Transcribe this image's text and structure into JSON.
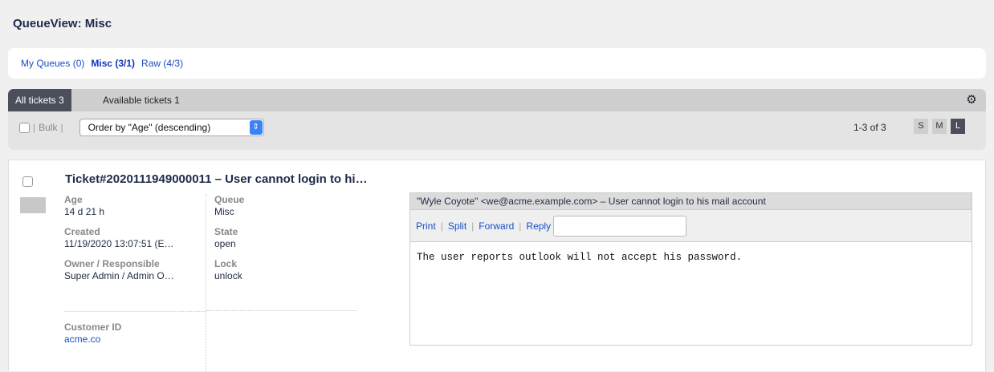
{
  "page": {
    "title": "QueueView: Misc"
  },
  "queues": [
    {
      "label": "My Queues (0)",
      "active": false
    },
    {
      "label": "Misc (3/1)",
      "active": true
    },
    {
      "label": "Raw (4/3)",
      "active": false
    }
  ],
  "tabs": {
    "all": "All tickets 3",
    "available": "Available tickets 1"
  },
  "toolbar": {
    "bulk_label": "Bulk",
    "order_value": "Order by \"Age\" (descending)",
    "pagination": "1-3 of 3",
    "sizes": [
      "S",
      "M",
      "L"
    ],
    "active_size": "L",
    "settings_icon": "gear-icon"
  },
  "ticket": {
    "title": "Ticket#2020111949000011 – User cannot login to hi…",
    "age_label": "Age",
    "age_value": "14 d 21 h",
    "created_label": "Created",
    "created_value": "11/19/2020 13:07:51 (E…",
    "owner_label": "Owner / Responsible",
    "owner_value": "Super Admin / Admin O…",
    "customer_label": "Customer ID",
    "customer_value": "acme.co",
    "queue_label": "Queue",
    "queue_value": "Misc",
    "state_label": "State",
    "state_value": "open",
    "lock_label": "Lock",
    "lock_value": "unlock",
    "article": {
      "header": "\"Wyle Coyote\" <we@acme.example.com> – User cannot login to his mail account",
      "actions": {
        "print": "Print",
        "split": "Split",
        "forward": "Forward",
        "reply": "Reply"
      },
      "body": "The user reports outlook will not accept his password."
    }
  }
}
